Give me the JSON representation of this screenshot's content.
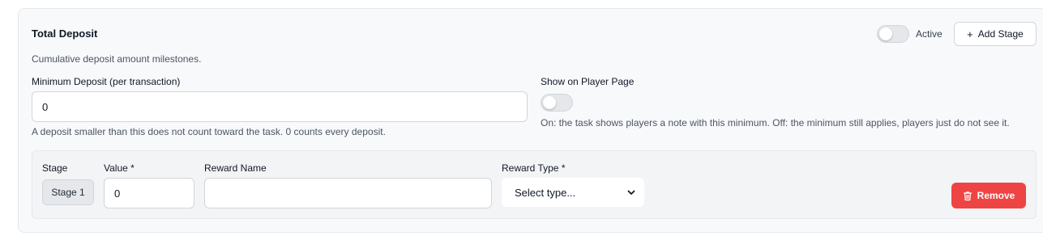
{
  "card": {
    "title": "Total Deposit",
    "description": "Cumulative deposit amount milestones."
  },
  "header": {
    "active_label": "Active",
    "active_on": false,
    "add_stage_label": "Add Stage",
    "add_stage_icon": "plus-icon"
  },
  "min_deposit": {
    "label": "Minimum Deposit (per transaction)",
    "value": "0",
    "hint": "A deposit smaller than this does not count toward the task. 0 counts every deposit."
  },
  "show_on_player_page": {
    "label": "Show on Player Page",
    "enabled": false,
    "hint": "On: the task shows players a note with this minimum. Off: the minimum still applies, players just do not see it."
  },
  "stage": {
    "stage_label": "Stage",
    "value_label": "Value *",
    "reward_name_label": "Reward Name",
    "reward_type_label": "Reward Type *",
    "stage_name": "Stage 1",
    "value": "0",
    "reward_name": "",
    "reward_type_selected": "Select type...",
    "remove_label": "Remove",
    "remove_icon": "trash-icon"
  },
  "colors": {
    "danger": "#ef4444",
    "card_bg": "#f8f9fb",
    "toggle_off": "#e5e7eb"
  }
}
